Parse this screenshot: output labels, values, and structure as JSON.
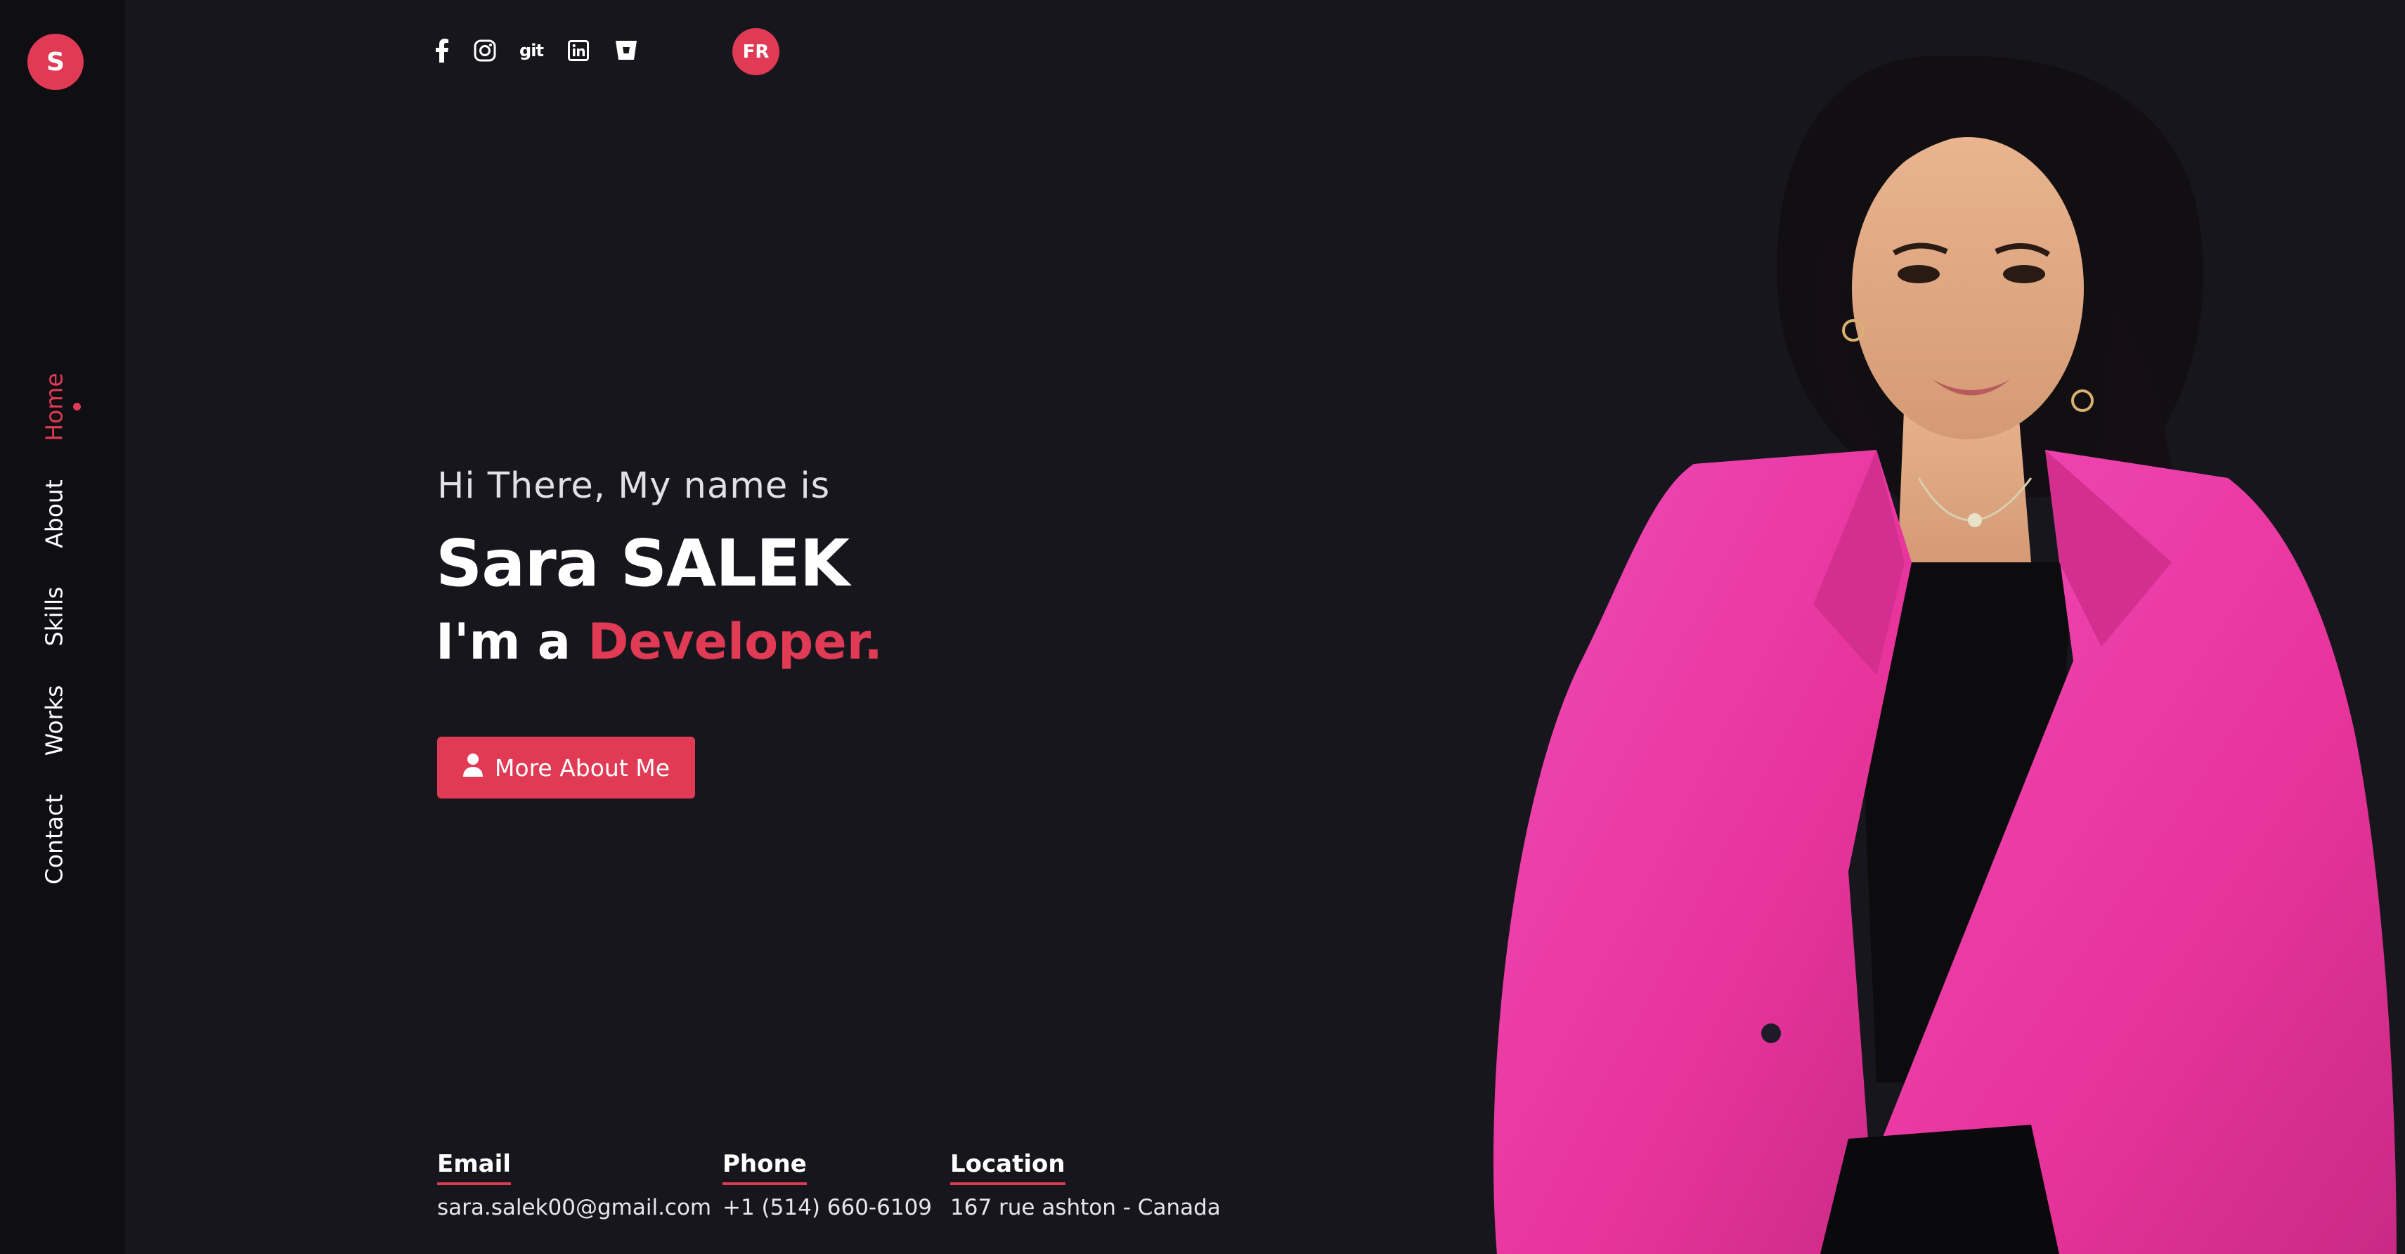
{
  "brand": {
    "logo_letter": "S",
    "accent_color": "#e03a55",
    "background_color": "#17161d",
    "sidebar_color": "#0f0e13"
  },
  "nav": {
    "items": [
      {
        "label": "Home",
        "active": true
      },
      {
        "label": "About",
        "active": false
      },
      {
        "label": "Skills",
        "active": false
      },
      {
        "label": "Works",
        "active": false
      },
      {
        "label": "Contact",
        "active": false
      }
    ]
  },
  "social": {
    "icons": [
      "facebook-icon",
      "instagram-icon",
      "git-icon",
      "linkedin-icon",
      "bitbucket-icon"
    ],
    "git_label": "git"
  },
  "language": {
    "label": "FR"
  },
  "hero": {
    "greeting": "Hi There, My name is",
    "name": "Sara SALEK",
    "role_prefix": "I'm a ",
    "role_highlight": "Developer.",
    "cta_label": "More About Me",
    "cta_icon": "user-icon"
  },
  "contact_info": {
    "email": {
      "label": "Email",
      "value": "sara.salek00@gmail.com"
    },
    "phone": {
      "label": "Phone",
      "value": "+1 (514) 660-6109"
    },
    "location": {
      "label": "Location",
      "value": "167 rue ashton - Canada"
    }
  }
}
